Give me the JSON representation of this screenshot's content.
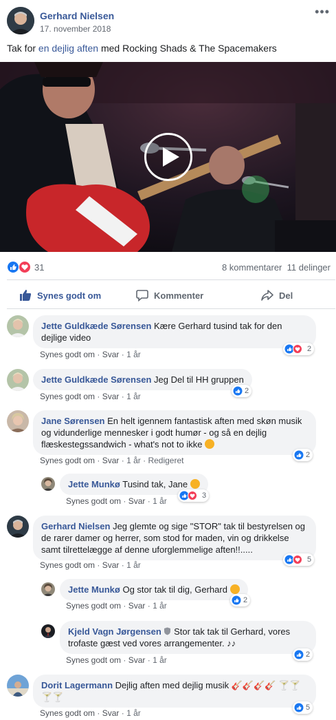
{
  "post": {
    "author": "Gerhard Nielsen",
    "date": "17. november 2018",
    "more_icon": "•••",
    "text_before": "Tak for ",
    "text_link": "en dejlig aften",
    "text_after": " med Rocking Shads & The Spacemakers"
  },
  "stats": {
    "reactions": "31",
    "comments": "8 kommentarer",
    "shares": "11 delinger"
  },
  "actions": {
    "like": "Synes godt om",
    "comment": "Kommenter",
    "share": "Del"
  },
  "comments": [
    {
      "name": "Jette Guldkæde Sørensen",
      "text": "Kære Gerhard tusind tak for den dejlige video",
      "like": "Synes godt om",
      "reply": "Svar",
      "time": "1 år",
      "edited": "",
      "count": "2"
    },
    {
      "name": "Jette Guldkæde Sørensen",
      "text": "Jeg Del til HH gruppen",
      "like": "Synes godt om",
      "reply": "Svar",
      "time": "1 år",
      "edited": "",
      "count": "2"
    },
    {
      "name": "Jane Sørensen",
      "text": "En helt igennem fantastisk aften med skøn musik og vidunderlige mennesker i godt humør - og så en dejlig flæskestegssandwich - what's not to ikke",
      "like": "Synes godt om",
      "reply": "Svar",
      "time": "1 år",
      "edited": "Redigeret",
      "count": "2"
    },
    {
      "name": "Jette Munkø",
      "text": "Tusind tak, Jane",
      "like": "Synes godt om",
      "reply": "Svar",
      "time": "1 år",
      "edited": "",
      "count": "3"
    },
    {
      "name": "Gerhard Nielsen",
      "text": "Jeg glemte og sige \"STOR\" tak til bestyrelsen og de rarer damer og herrer, som stod for maden, vin og drikkelse samt tilrettelægge af denne uforglemmelige aften!!.....",
      "like": "Synes godt om",
      "reply": "Svar",
      "time": "1 år",
      "edited": "",
      "count": "5"
    },
    {
      "name": "Jette Munkø",
      "text": "Og stor tak til dig, Gerhard",
      "like": "Synes godt om",
      "reply": "Svar",
      "time": "1 år",
      "edited": "",
      "count": "2"
    },
    {
      "name": "Kjeld Vagn Jørgensen",
      "text": "Stor tak tak til Gerhard, vores trofaste gæst ved vores arrangementer.",
      "like": "Synes godt om",
      "reply": "Svar",
      "time": "1 år",
      "edited": "",
      "count": "2"
    },
    {
      "name": "Dorit Lagermann",
      "text": "Dejlig aften med dejlig musik",
      "like": "Synes godt om",
      "reply": "Svar",
      "time": "1 år",
      "edited": "",
      "count": "5"
    }
  ],
  "colors": {
    "link": "#385898",
    "like_blue": "#1877f2",
    "love_red": "#f33e58",
    "bubble": "#f2f3f5"
  }
}
